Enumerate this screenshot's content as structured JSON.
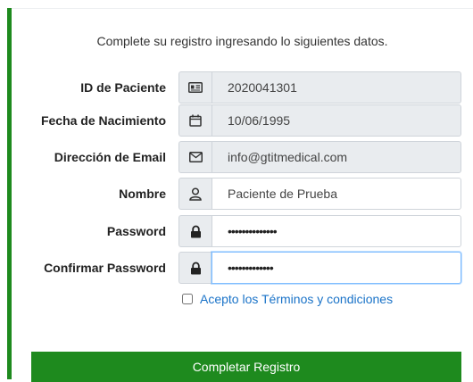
{
  "intro": "Complete su registro ingresando lo siguientes datos.",
  "fields": [
    {
      "label": "ID de Paciente",
      "value": "2020041301",
      "icon": "id-card-icon"
    },
    {
      "label": "Fecha de Nacimiento",
      "value": "10/06/1995",
      "icon": "calendar-icon"
    },
    {
      "label": "Dirección de Email",
      "value": "info@gtitmedical.com",
      "icon": "envelope-icon"
    },
    {
      "label": "Nombre",
      "value": "Paciente de Prueba",
      "icon": "user-icon"
    },
    {
      "label": "Password",
      "value": "••••••••••••••",
      "icon": "lock-icon"
    },
    {
      "label": "Confirmar Password",
      "value": "•••••••••••••",
      "icon": "lock-icon"
    }
  ],
  "terms_label": "Acepto los Términos y condiciones",
  "submit_label": "Completar Registro",
  "colors": {
    "accent": "#1e8a1e",
    "link": "#1a73c8",
    "addon_bg": "#e9ecef"
  }
}
